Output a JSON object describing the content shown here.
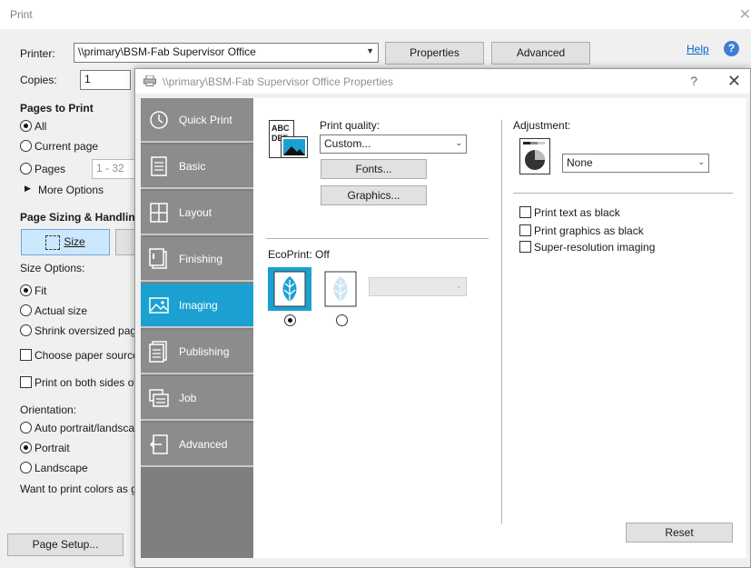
{
  "print_window": {
    "title": "Print",
    "close_glyph": "✕",
    "printer_label": "Printer:",
    "printer_value": "\\\\primary\\BSM-Fab Supervisor Office",
    "properties_button": "Properties",
    "advanced_button": "Advanced",
    "help_link": "Help",
    "copies_label": "Copies:",
    "copies_value": "1",
    "pages_to_print": {
      "heading": "Pages to Print",
      "all": "All",
      "current_page": "Current page",
      "pages": "Pages",
      "pages_placeholder": "1 - 32",
      "more_options": "More Options"
    },
    "page_sizing": {
      "heading": "Page Sizing & Handling",
      "size_button": "Size",
      "size_options_label": "Size Options:",
      "fit": "Fit",
      "actual_size": "Actual size",
      "shrink": "Shrink oversized page",
      "choose_paper": "Choose paper source",
      "both_sides": "Print on both sides of"
    },
    "orientation": {
      "heading": "Orientation:",
      "auto": "Auto portrait/landsca",
      "portrait": "Portrait",
      "landscape": "Landscape"
    },
    "colors_text": "Want to print colors as g",
    "page_setup_button": "Page Setup..."
  },
  "properties_dialog": {
    "title": "\\\\primary\\BSM-Fab Supervisor Office Properties",
    "help_glyph": "?",
    "close_glyph": "✕",
    "nav": [
      {
        "label": "Quick Print",
        "icon": "clock-icon"
      },
      {
        "label": "Basic",
        "icon": "document-icon"
      },
      {
        "label": "Layout",
        "icon": "layout-grid-icon"
      },
      {
        "label": "Finishing",
        "icon": "finishing-icon"
      },
      {
        "label": "Imaging",
        "icon": "image-icon"
      },
      {
        "label": "Publishing",
        "icon": "publishing-icon"
      },
      {
        "label": "Job",
        "icon": "job-icon"
      },
      {
        "label": "Advanced",
        "icon": "advanced-icon"
      }
    ],
    "active_nav": "Imaging",
    "imaging": {
      "abc_text": "ABC",
      "def_text": "DEF",
      "print_quality_label": "Print quality:",
      "print_quality_value": "Custom...",
      "fonts_button": "Fonts...",
      "graphics_button": "Graphics...",
      "ecoprint_label": "EcoPrint:",
      "ecoprint_value": "Off",
      "adjustment_label": "Adjustment:",
      "adjustment_value": "None",
      "print_text_black": "Print text as black",
      "print_graphics_black": "Print graphics as black",
      "super_resolution": "Super-resolution imaging",
      "reset_button": "Reset"
    }
  },
  "colors": {
    "accent": "#1ba1d1",
    "sidebar": "#8c8c8c",
    "link": "#0066cc"
  }
}
